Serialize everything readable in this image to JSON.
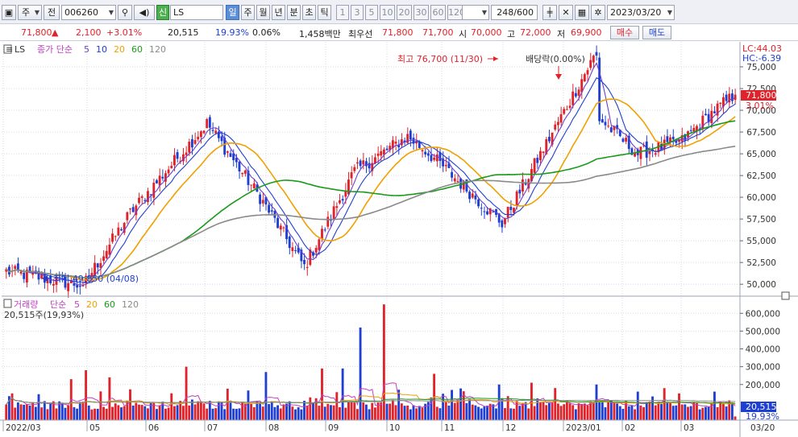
{
  "toolbar": {
    "market": "주",
    "period_type": "전",
    "code": "006260",
    "name_badge": "신",
    "name": "LS",
    "periods": [
      "일",
      "주",
      "월",
      "년",
      "분",
      "초",
      "틱"
    ],
    "intervals": [
      "1",
      "3",
      "5",
      "10",
      "20",
      "30",
      "60",
      "120"
    ],
    "count": "248",
    "count_total": "/600",
    "date": "2023/03/20"
  },
  "quote": {
    "price": "71,800",
    "change": "2,100",
    "change_pct": "+3.01%",
    "volume": "20,515",
    "volume_pct": "19.93%",
    "turnover_pct": "0.06%",
    "amount": "1,458백만",
    "best_label": "최우선",
    "ask": "71,800",
    "bid": "71,700",
    "open_label": "시",
    "open": "70,000",
    "high_label": "고",
    "high": "72,000",
    "low_label": "저",
    "low": "69,900",
    "buy_label": "매수",
    "sell_label": "매도"
  },
  "price_pane": {
    "legend_name": "LS",
    "legend_title": "종가 단순",
    "ma": [
      {
        "period": "5",
        "color": "#6a3fd0"
      },
      {
        "period": "10",
        "color": "#1f3fd0"
      },
      {
        "period": "20",
        "color": "#f0a000"
      },
      {
        "period": "60",
        "color": "#1a9a1a"
      },
      {
        "period": "120",
        "color": "#8a8a8a"
      }
    ],
    "lc_label": "LC:44.03",
    "hc_label": "HC:-6.39",
    "last_price_label": "71,800",
    "last_pct_label": "3.01%",
    "high_annotation": "최고 76,700 (11/30)",
    "low_annotation": "최저 49,850 (04/08)",
    "dividend_annotation": "배당락(0.00%)",
    "y_ticks": [
      "75,000",
      "72,500",
      "70,000",
      "67,500",
      "65,000",
      "62,500",
      "60,000",
      "57,500",
      "55,000",
      "52,500",
      "50,000"
    ]
  },
  "volume_pane": {
    "legend_title": "거래량",
    "legend_type": "단순",
    "ma": [
      {
        "period": "5",
        "color": "#c040c0"
      },
      {
        "period": "20",
        "color": "#f0a000"
      },
      {
        "period": "60",
        "color": "#1a9a1a"
      },
      {
        "period": "120",
        "color": "#8a8a8a"
      }
    ],
    "volume_label": "20,515주(19,93%)",
    "last_volume_label": "20,515",
    "last_pct_label": "19.93%",
    "y_ticks": [
      "600,000",
      "500,000",
      "400,000",
      "300,000",
      "200,000"
    ]
  },
  "x_axis": {
    "labels": [
      "2022/03",
      "05",
      "06",
      "07",
      "08",
      "09",
      "10",
      "11",
      "12",
      "2023/01",
      "02",
      "03",
      "03/20"
    ]
  },
  "colors": {
    "up": "#e0222a",
    "down": "#1f3fd0",
    "grid": "#d8dbe2",
    "price_tag": "#e0222a",
    "volume_tag": "#1f3fd0"
  },
  "chart_data": {
    "type": "candlestick",
    "ylim": [
      49000,
      77500
    ],
    "anchors": [
      {
        "x": "2022/03",
        "close": 51500
      },
      {
        "x": "2022/04/08",
        "close": 49850
      },
      {
        "x": "2022/05",
        "close": 58200
      },
      {
        "x": "2022/06",
        "close": 68500
      },
      {
        "x": "2022/06 end",
        "close": 60000
      },
      {
        "x": "2022/07",
        "close": 52000
      },
      {
        "x": "2022/08",
        "close": 63000
      },
      {
        "x": "2022/08 end",
        "close": 67000
      },
      {
        "x": "2022/09",
        "close": 64500
      },
      {
        "x": "2022/10",
        "close": 57000
      },
      {
        "x": "2022/11",
        "close": 68000
      },
      {
        "x": "2022/11/30",
        "close": 76700
      },
      {
        "x": "2022/12",
        "close": 69000
      },
      {
        "x": "2023/01",
        "close": 65000
      },
      {
        "x": "2023/02",
        "close": 66500
      },
      {
        "x": "2023/03",
        "close": 70000
      },
      {
        "x": "2023/03/20",
        "close": 71800
      }
    ]
  }
}
